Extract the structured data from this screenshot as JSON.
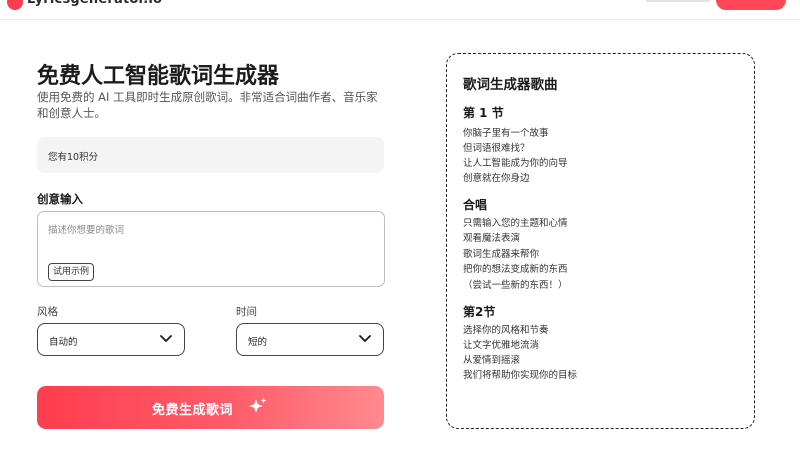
{
  "header": {
    "brand": "Lyricsgenerator.io"
  },
  "main": {
    "title": "免费人工智能歌词生成器",
    "subtitle": "使用免费的 AI 工具即时生成原创歌词。非常适合词曲作者、音乐家和创意人士。",
    "credits_text": "您有10积分",
    "input_label": "创意输入",
    "input_placeholder": "描述你想要的歌词",
    "example_button": "试用示例",
    "style_label": "风格",
    "style_value": "自动的",
    "length_label": "时间",
    "length_value": "短的",
    "generate_button": "免费生成歌词"
  },
  "song_card": {
    "title": "歌词生成器歌曲",
    "sections": [
      {
        "title": "第 1 节",
        "lines": [
          "你脑子里有一个故事",
          "但词语很难找？",
          "让人工智能成为你的向导",
          "创意就在你身边"
        ]
      },
      {
        "title": "合唱",
        "lines": [
          "只需输入您的主题和心情",
          "观看魔法表演",
          "歌词生成器来帮你",
          "把你的想法变成新的东西",
          "（尝试一些新的东西！）"
        ]
      },
      {
        "title": "第2节",
        "lines": [
          "选择你的风格和节奏",
          "让文字优雅地流淌",
          "从爱情到摇滚",
          "我们将帮助你实现你的目标"
        ]
      }
    ]
  },
  "colors": {
    "accent": "#ff3d4f",
    "accent_light": "#ff8a90",
    "text": "#1b1b1b"
  },
  "icons": {
    "select_arrow": "chevron-down-icon",
    "generate": "sparkle-icon",
    "brand": "logo-icon"
  }
}
